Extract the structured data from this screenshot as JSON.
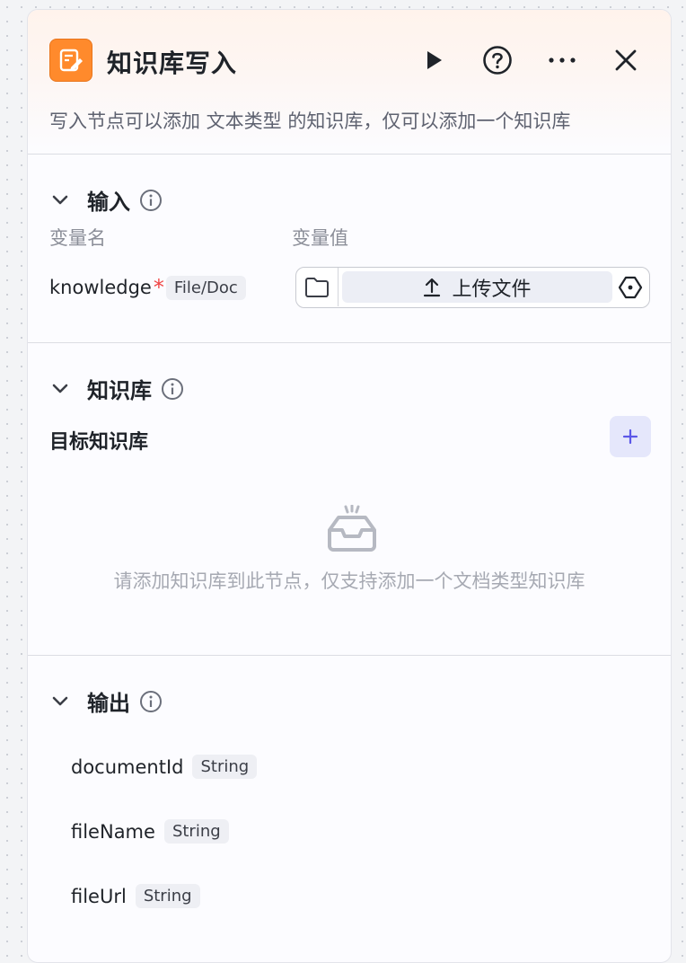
{
  "node": {
    "title": "知识库写入",
    "description": "写入节点可以添加 文本类型 的知识库，仅可以添加一个知识库",
    "icon": "knowledge-write-icon",
    "accent": "#ff8a2c"
  },
  "input": {
    "section_label": "输入",
    "col_name": "变量名",
    "col_value": "变量值",
    "var_name": "knowledge",
    "required_mark": "*",
    "var_type": "File/Doc",
    "upload_label": "上传文件"
  },
  "knowledge": {
    "section_label": "知识库",
    "target_label": "目标知识库",
    "empty_text": "请添加知识库到此节点，仅支持添加一个文档类型知识库"
  },
  "output": {
    "section_label": "输出",
    "items": [
      {
        "name": "documentId",
        "type": "String"
      },
      {
        "name": "fileName",
        "type": "String"
      },
      {
        "name": "fileUrl",
        "type": "String"
      }
    ]
  }
}
